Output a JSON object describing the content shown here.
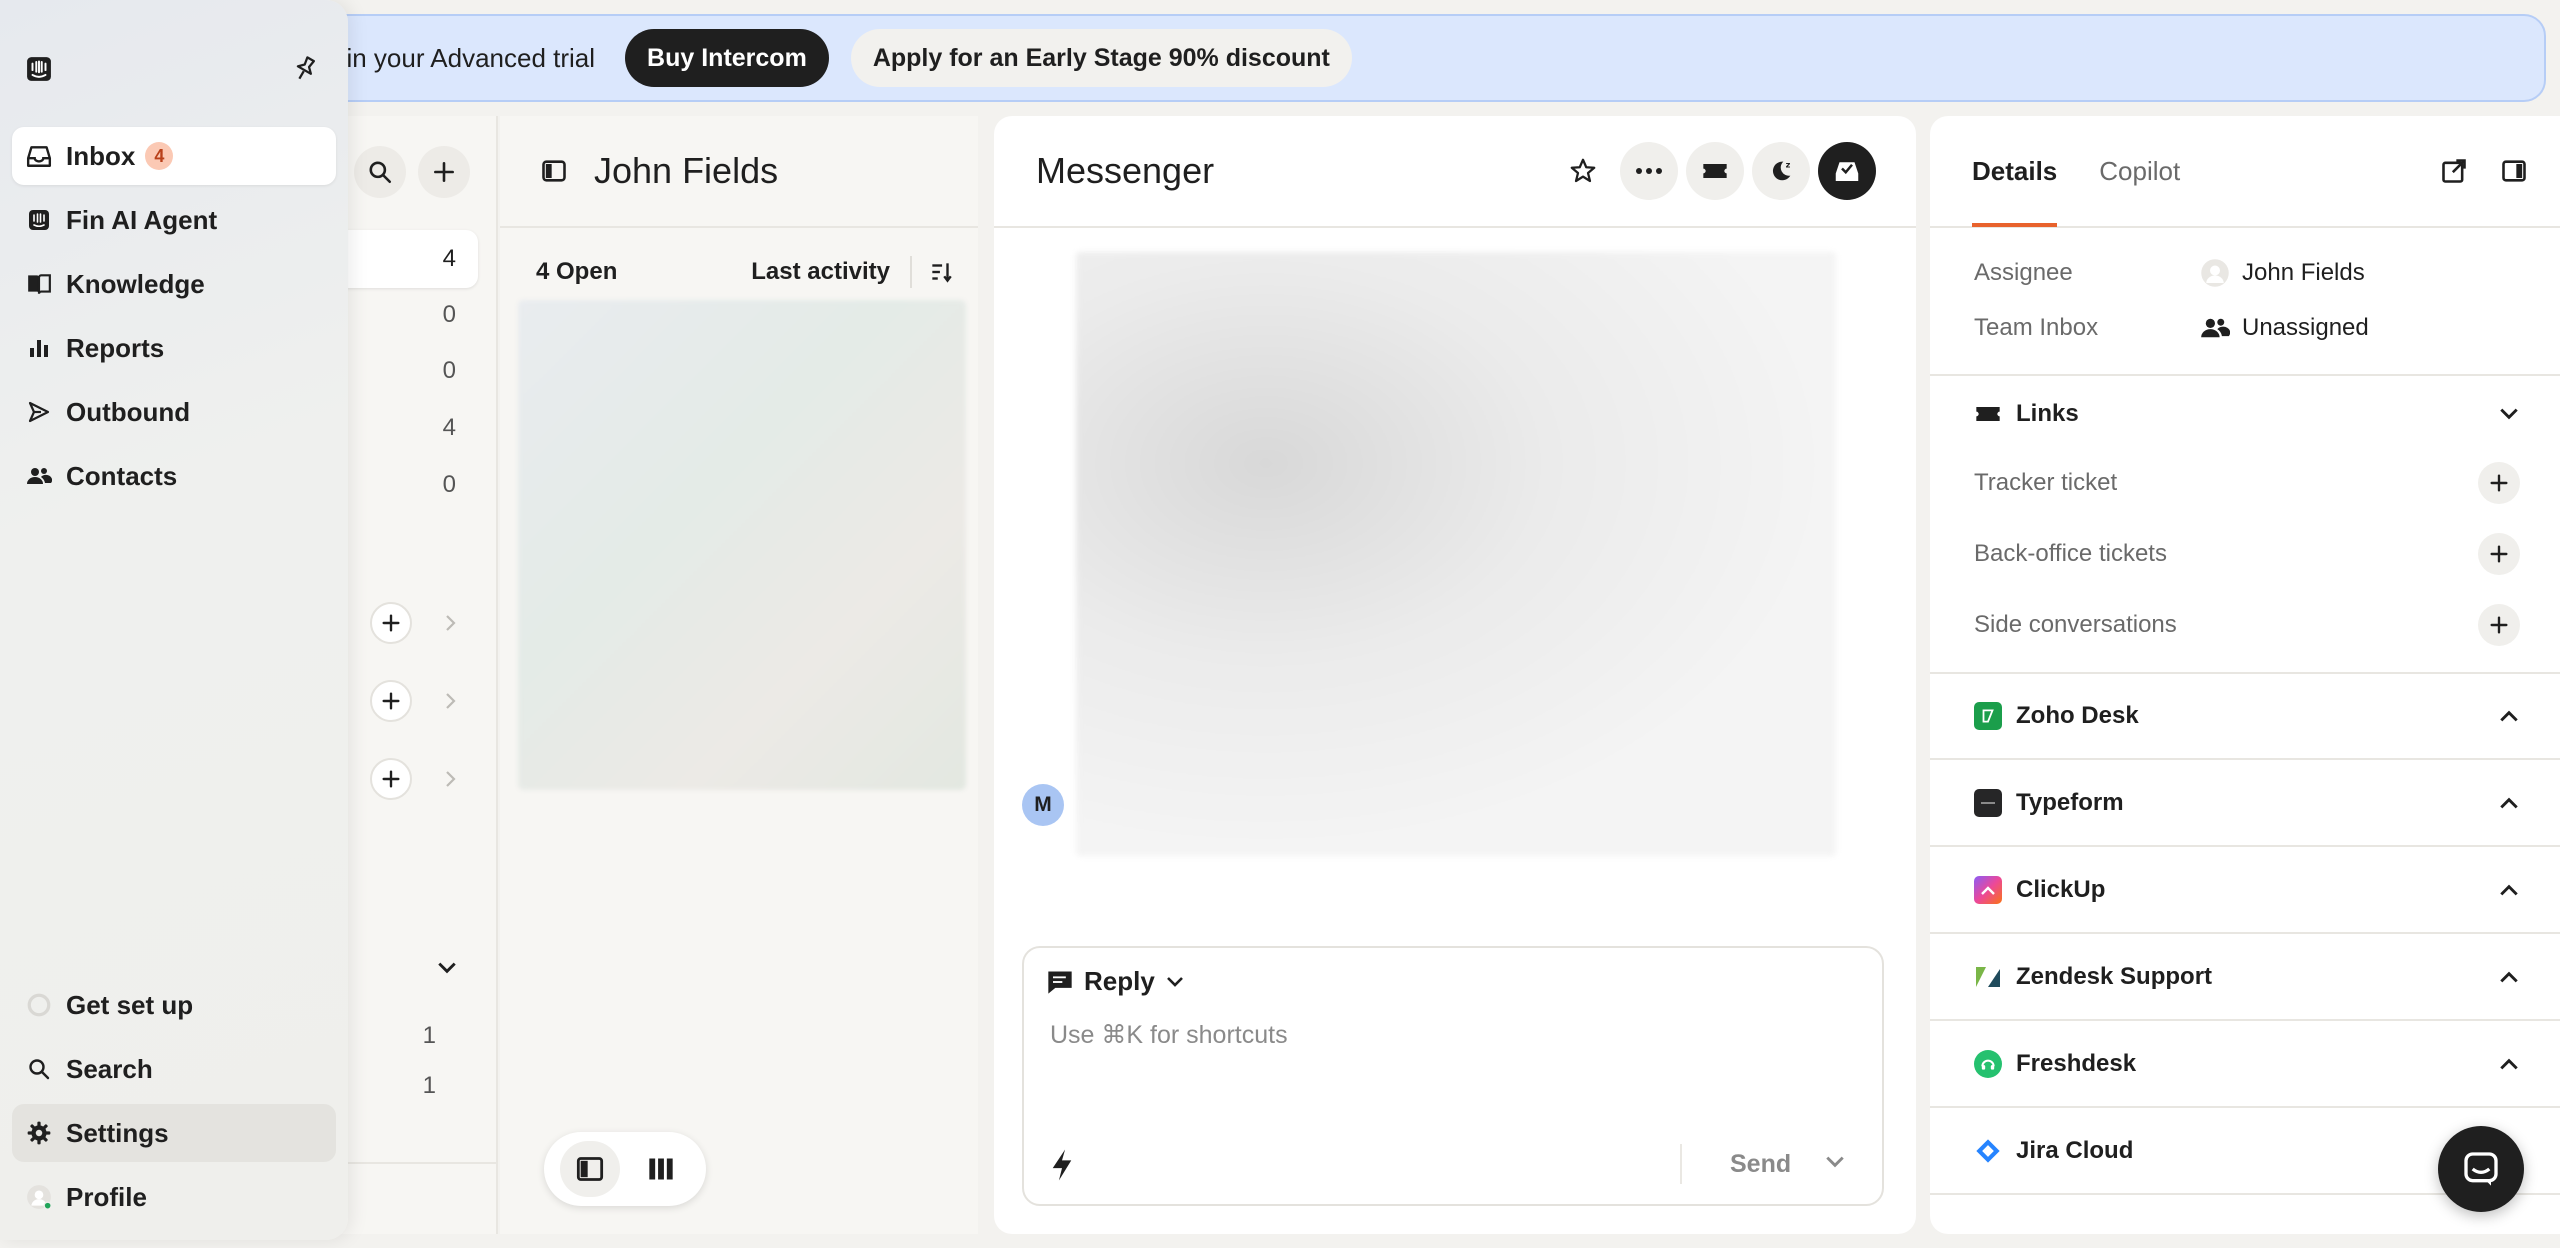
{
  "banner": {
    "text": "t in your Advanced trial",
    "buy_label": "Buy Intercom",
    "discount_label": "Apply for an Early Stage 90% discount"
  },
  "inbox_counts": [
    "4",
    "0",
    "0",
    "4",
    "0"
  ],
  "inbox_counts_lower": [
    "1",
    "1"
  ],
  "conversation_list": {
    "title": "John Fields",
    "open_count": "4 Open",
    "sort_label": "Last activity"
  },
  "messenger": {
    "title": "Messenger",
    "avatar_initial": "M",
    "reply_label": "Reply",
    "placeholder": "Use ⌘K for shortcuts",
    "send_label": "Send"
  },
  "details": {
    "tabs": [
      "Details",
      "Copilot"
    ],
    "assignee_label": "Assignee",
    "assignee_value": "John Fields",
    "team_label": "Team Inbox",
    "team_value": "Unassigned",
    "links_label": "Links",
    "links": [
      "Tracker ticket",
      "Back-office tickets",
      "Side conversations"
    ],
    "apps": [
      "Zoho Desk",
      "Typeform",
      "ClickUp",
      "Zendesk Support",
      "Freshdesk",
      "Jira Cloud"
    ]
  },
  "nav": {
    "items": [
      {
        "label": "Inbox",
        "badge": "4"
      },
      {
        "label": "Fin AI Agent"
      },
      {
        "label": "Knowledge"
      },
      {
        "label": "Reports"
      },
      {
        "label": "Outbound"
      },
      {
        "label": "Contacts"
      }
    ],
    "bottom": [
      {
        "label": "Get set up"
      },
      {
        "label": "Search"
      },
      {
        "label": "Settings"
      },
      {
        "label": "Profile"
      }
    ]
  },
  "colors": {
    "accent": "#e8622c",
    "banner_bg": "#dbe7fd",
    "dark": "#1f1f1f"
  }
}
